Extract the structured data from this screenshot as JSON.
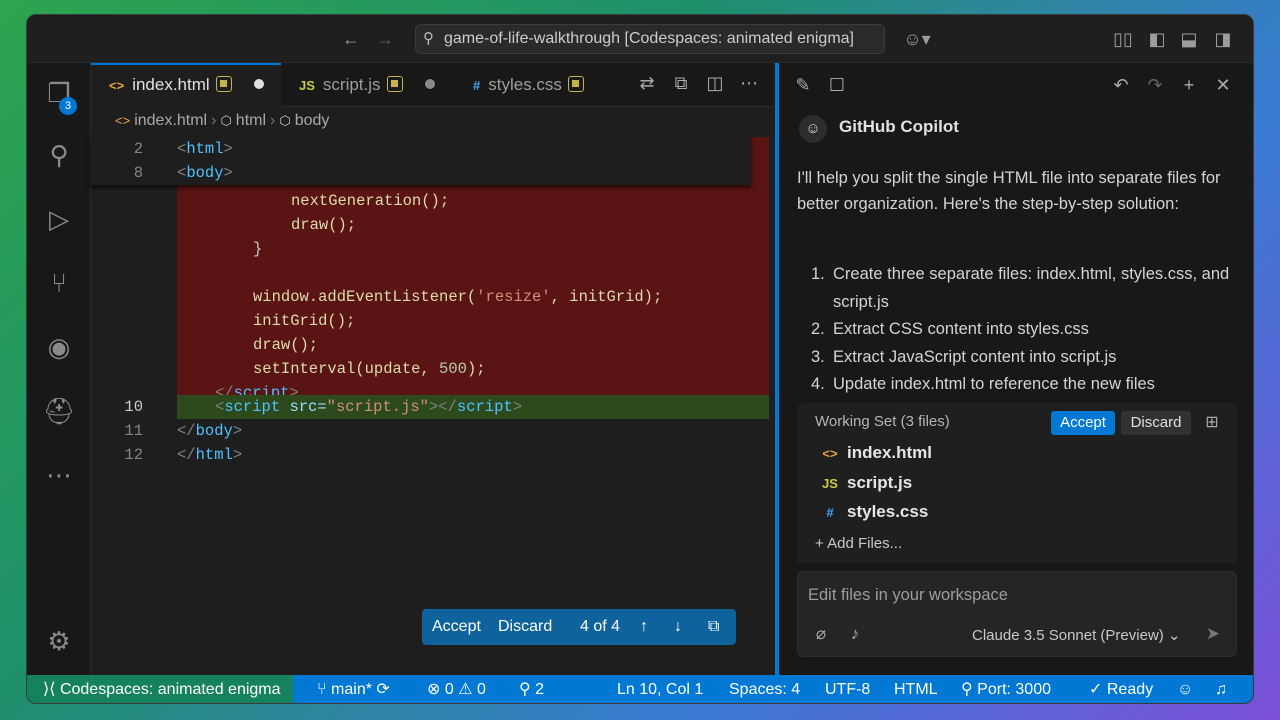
{
  "titlebar": {
    "command_center": "game-of-life-walkthrough [Codespaces: animated enigma]"
  },
  "activity": {
    "scm_badge": "3"
  },
  "tabs": [
    {
      "type_icon": "<>",
      "label": "index.html",
      "type_color": "#e8a33d"
    },
    {
      "type_icon": "JS",
      "label": "script.js",
      "type_color": "#cbcb41"
    },
    {
      "type_icon": "#",
      "label": "styles.css",
      "type_color": "#42a5f5"
    }
  ],
  "breadcrumb": [
    "index.html",
    "html",
    "body"
  ],
  "code": {
    "sticky": [
      {
        "ln": "2",
        "text": "html"
      },
      {
        "ln": "8",
        "text": "body"
      }
    ],
    "deleted": {
      "l1": "nextGeneration();",
      "l2": "draw();",
      "l3": "}",
      "l5_fn": "window.addEventListener(",
      "l5_str": "'resize'",
      "l5_rest": ", initGrid);",
      "l6": "initGrid();",
      "l7": "draw();",
      "l8_fn": "setInterval(update, ",
      "l8_num": "500",
      "l8_end": ");",
      "l9_tag": "script"
    },
    "added": {
      "ln": "10",
      "tag": "script",
      "attr": "src=",
      "val": "\"script.js\"",
      "close": "script"
    },
    "line11": {
      "ln": "11",
      "tag": "body"
    },
    "line12": {
      "ln": "12",
      "tag": "html"
    }
  },
  "floatbar": {
    "accept": "Accept",
    "discard": "Discard",
    "counter": "4 of 4"
  },
  "chat": {
    "title": "GitHub Copilot",
    "intro": "I'll help you split the single HTML file into separate files for better organization. Here's the step-by-step solution:",
    "steps": [
      "Create three separate files: index.html, styles.css, and script.js",
      "Extract CSS content into styles.css",
      "Extract JavaScript content into script.js",
      "Update index.html to reference the new files"
    ],
    "working_set": {
      "title": "Working Set (3 files)",
      "accept": "Accept",
      "discard": "Discard",
      "files": [
        "index.html",
        "script.js",
        "styles.css"
      ],
      "add_files": "Add Files..."
    },
    "input_placeholder": "Edit files in your workspace",
    "model": "Claude 3.5 Sonnet (Preview)"
  },
  "statusbar": {
    "remote": "Codespaces: animated enigma",
    "branch": "main*",
    "errors": "0",
    "warnings": "0",
    "ports_count": "2",
    "position": "Ln 10, Col 1",
    "spaces": "Spaces: 4",
    "encoding": "UTF-8",
    "language": "HTML",
    "port": "Port: 3000",
    "ready": "Ready"
  },
  "colors": {
    "accent": "#0078d4",
    "remote": "#16825d",
    "diff_removed": "#5a1414",
    "diff_added": "#2d4a1c"
  }
}
